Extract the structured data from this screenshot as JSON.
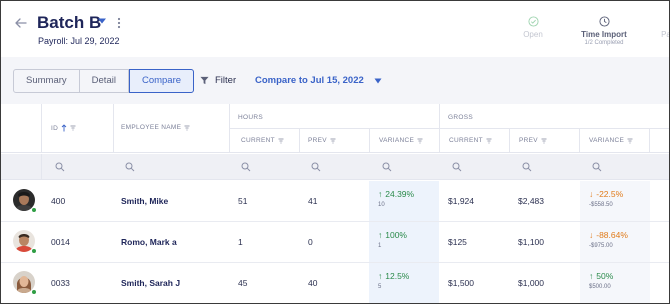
{
  "header": {
    "title": "Batch B",
    "payroll_date": "Payroll: Jul 29, 2022",
    "steps": [
      {
        "label": "Open",
        "sub": ""
      },
      {
        "label": "Time Import",
        "sub": "1/2 Completed"
      },
      {
        "label": "Pay",
        "sub": ""
      }
    ]
  },
  "toolbar": {
    "tabs": [
      "Summary",
      "Detail",
      "Compare"
    ],
    "active_tab": "Compare",
    "filter_label": "Filter",
    "compare_label": "Compare to Jul 15, 2022"
  },
  "table": {
    "headers": {
      "id": "ID",
      "employee_name": "EMPLOYEE NAME",
      "hours": "HOURS",
      "gross": "GROSS",
      "current": "CURRENT",
      "prev": "PREV",
      "variance": "VARIANCE"
    },
    "rows": [
      {
        "id": "400",
        "name": "Smith, Mike",
        "hours_current": "51",
        "hours_prev": "41",
        "hours_var": "24.39%",
        "hours_var_sub": "10",
        "hours_dir": "up",
        "gross_current": "$1,924",
        "gross_prev": "$2,483",
        "gross_var": "-22.5%",
        "gross_var_sub": "-$558.50",
        "gross_dir": "down"
      },
      {
        "id": "0014",
        "name": "Romo, Mark a",
        "hours_current": "1",
        "hours_prev": "0",
        "hours_var": "100%",
        "hours_var_sub": "1",
        "hours_dir": "up",
        "gross_current": "$125",
        "gross_prev": "$1,100",
        "gross_var": "-88.64%",
        "gross_var_sub": "-$975.00",
        "gross_dir": "down"
      },
      {
        "id": "0033",
        "name": "Smith, Sarah J",
        "hours_current": "45",
        "hours_prev": "40",
        "hours_var": "12.5%",
        "hours_var_sub": "5",
        "hours_dir": "up",
        "gross_current": "$1,500",
        "gross_prev": "$1,000",
        "gross_var": "50%",
        "gross_var_sub": "$500.00",
        "gross_dir": "up"
      }
    ]
  },
  "colors": {
    "accent": "#3a63c8",
    "positive": "#2a8a4a",
    "negative": "#e07b1a",
    "title": "#1e2559"
  }
}
